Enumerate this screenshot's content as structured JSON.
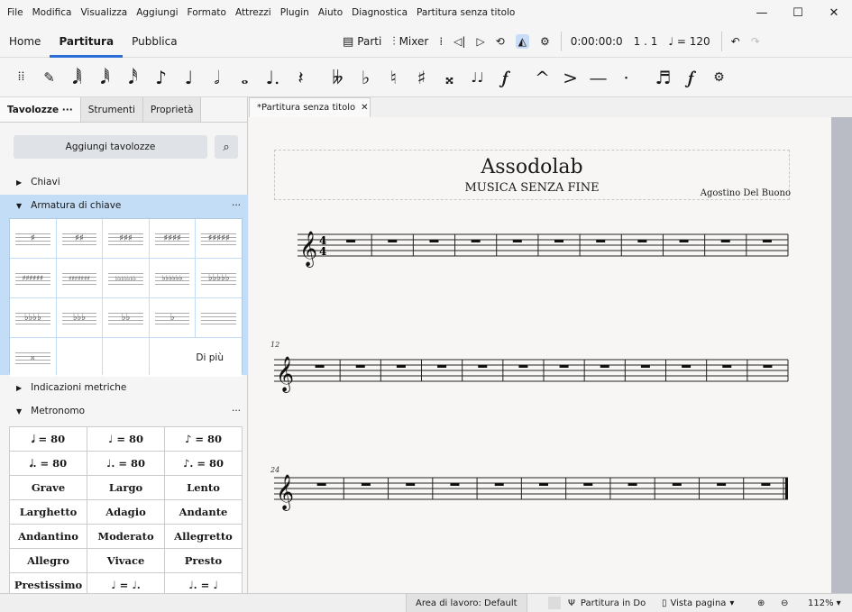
{
  "menu": [
    "File",
    "Modifica",
    "Visualizza",
    "Aggiungi",
    "Formato",
    "Attrezzi",
    "Plugin",
    "Aiuto",
    "Diagnostica",
    "Partitura senza titolo"
  ],
  "window_controls": {
    "minimize": "—",
    "maximize": "☐",
    "close": "✕"
  },
  "workspace_tabs": [
    {
      "label": "Home"
    },
    {
      "label": "Partitura",
      "active": true
    },
    {
      "label": "Pubblica"
    }
  ],
  "toolbar": {
    "parts_label": "Parti",
    "mixer_label": "Mixer",
    "time": "0:00:00:0",
    "position": "1 . 1",
    "tempo": "= 120"
  },
  "note_toolbar": [
    "𝅘𝅥𝅲",
    "𝅘𝅥𝅱",
    "𝅘𝅥𝅰",
    "♪",
    "♩",
    "𝅗𝅥",
    "𝅝",
    "♩.",
    "𝄽",
    "𝄫",
    "♭",
    "♮",
    "♯",
    "𝄪",
    "♩♩",
    "𝆑",
    "^",
    ">",
    "—",
    "·",
    "♬",
    "𝆑",
    "⚙"
  ],
  "panel": {
    "tabs": [
      {
        "label": "Tavolozze  ···",
        "active": true
      },
      {
        "label": "Strumenti"
      },
      {
        "label": "Proprietà"
      }
    ],
    "add_palettes": "Aggiungi tavolozze",
    "sections": {
      "clefs": "Chiavi",
      "keysig": "Armatura di chiave",
      "timesig": "Indicazioni metriche",
      "metronome": "Metronomo"
    },
    "keysig_cells": [
      "♯",
      "♯♯",
      "♯♯♯",
      "♯♯♯♯",
      "♯♯♯♯♯",
      "♯♯♯♯♯♯",
      "♯♯♯♯♯♯♯",
      "♭♭♭♭♭♭♭",
      "♭♭♭♭♭♭",
      "♭♭♭♭♭",
      "♭♭♭♭",
      "♭♭♭",
      "♭♭",
      "♭",
      "",
      "𝄪",
      "",
      "",
      "Di più",
      ""
    ],
    "metronome_cells": [
      "𝅗𝅥 = 80",
      "♩ = 80",
      "♪ = 80",
      "𝅗𝅥. = 80",
      "♩. = 80",
      "♪. = 80",
      "Grave",
      "Largo",
      "Lento",
      "Larghetto",
      "Adagio",
      "Andante",
      "Andantino",
      "Moderato",
      "Allegretto",
      "Allegro",
      "Vivace",
      "Presto",
      "Prestissimo",
      "♩ = ♩.",
      "♩. = ♩"
    ]
  },
  "document_tab": "*Partitura senza titolo",
  "score": {
    "title": "Assodolab",
    "subtitle": "MUSICA SENZA FINE",
    "composer": "Agostino Del Buono",
    "measure_numbers": [
      "12",
      "24"
    ]
  },
  "status": {
    "workspace": "Area di lavoro: Default",
    "concert_pitch": "Partitura in Do",
    "view": "Vista pagina",
    "zoom": "112%"
  }
}
